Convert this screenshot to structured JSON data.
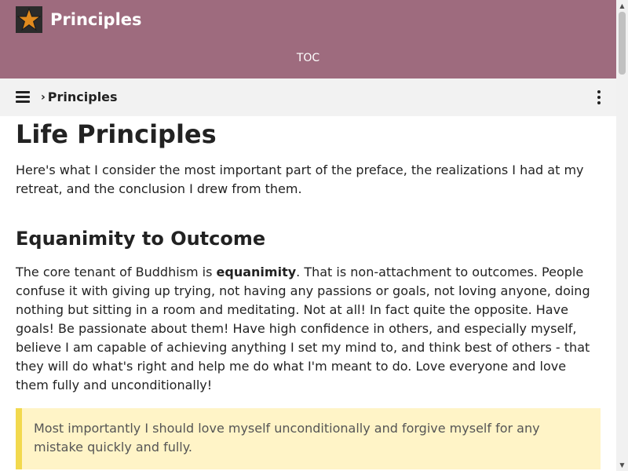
{
  "site": {
    "title": "Principles",
    "toc_label": "TOC"
  },
  "toolbar": {
    "breadcrumb_separator": "›",
    "breadcrumb_current": "Principles"
  },
  "article": {
    "title": "Life Principles",
    "intro": "Here's what I consider the most important part of the preface, the realizations I had at my retreat, and the conclusion I drew from them.",
    "section_title": "Equanimity to Outcome",
    "body_before": "The core tenant of Buddhism is ",
    "body_bold": "equanimity",
    "body_after": ". That is non-attachment to outcomes. People confuse it with giving up trying, not having any passions or goals, not loving anyone, doing nothing but sitting in a room and meditating. Not at all! In fact quite the opposite. Have goals! Be passionate about them! Have high confidence in others, and especially myself, believe I am capable of achieving anything I set my mind to, and think best of others - that they will do what's right and help me do what I'm meant to do. Love everyone and love them fully and unconditionally!",
    "callout": "Most importantly I should love myself unconditionally and forgive myself for any mistake quickly and fully."
  },
  "icons": {
    "logo": "star-logo-icon",
    "menu": "hamburger-menu-icon",
    "breadcrumb": "chevron-right-icon",
    "more": "kebab-menu-icon",
    "scroll_up": "arrow-up-icon",
    "scroll_down": "arrow-down-icon"
  },
  "colors": {
    "header_bg": "#9e6b7e",
    "toolbar_bg": "#f2f2f2",
    "logo_star": "#e08a1e",
    "callout_bg": "#fff4c7",
    "callout_border": "#f2d94e",
    "text": "#222222",
    "callout_text": "#555555"
  }
}
